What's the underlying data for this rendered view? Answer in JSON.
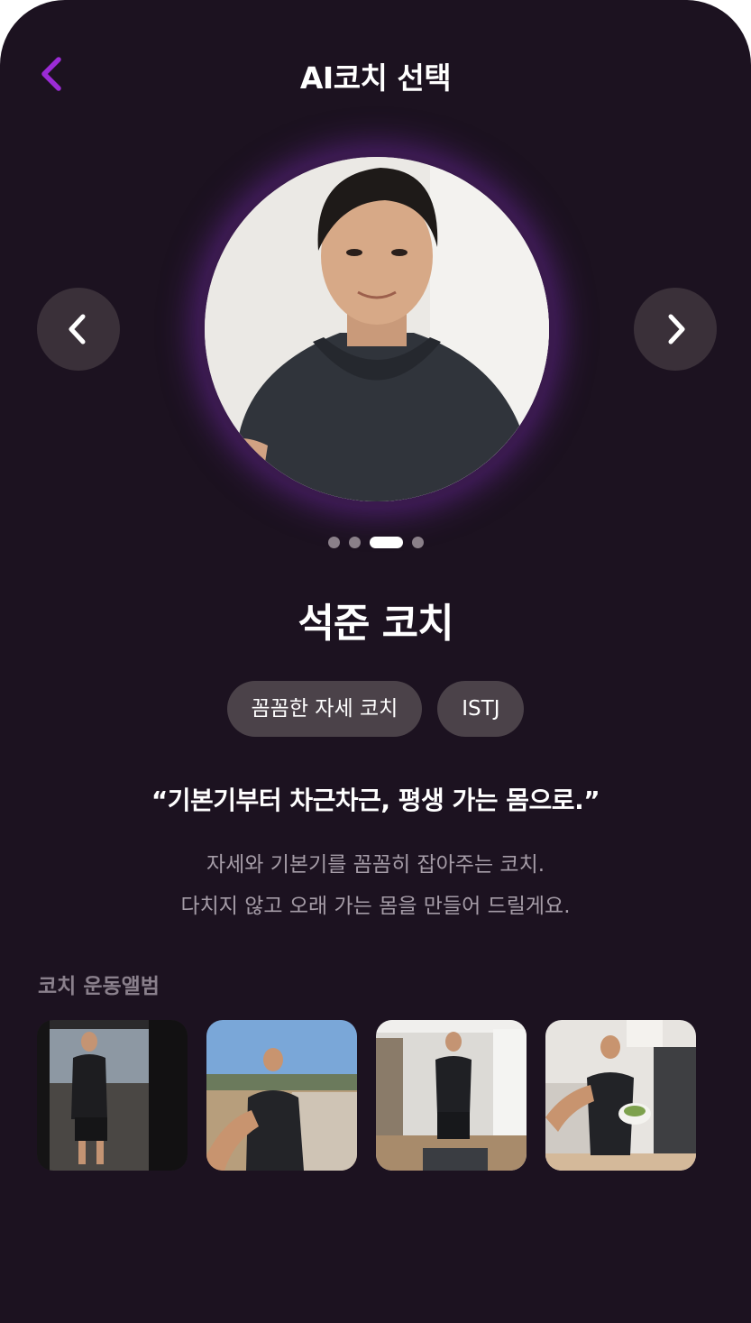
{
  "header": {
    "title": "AI코치 선택",
    "back_icon": "chevron-left-icon",
    "accent_color": "#9b2bd6"
  },
  "carousel": {
    "prev_icon": "chevron-left-icon",
    "next_icon": "chevron-right-icon",
    "total": 4,
    "active_index": 2
  },
  "coach": {
    "name": "석준 코치",
    "tags": [
      "꼼꼼한 자세 코치",
      "ISTJ"
    ],
    "quote": "“기본기부터 차근차근, 평생 가는 몸으로.”",
    "description": [
      "자세와 기본기를 꼼꼼히 잡아주는 코치.",
      "다치지 않고 오래 가는 몸을 만들어 드릴게요."
    ]
  },
  "album": {
    "title": "코치 운동앨범",
    "photos": [
      "gym-mirror-selfie",
      "park-path-selfie",
      "room-mirror-selfie",
      "kitchen-salad-selfie"
    ]
  },
  "colors": {
    "background": "#1c1220",
    "glow": "#6e28a0",
    "chip": "#4b4249"
  }
}
